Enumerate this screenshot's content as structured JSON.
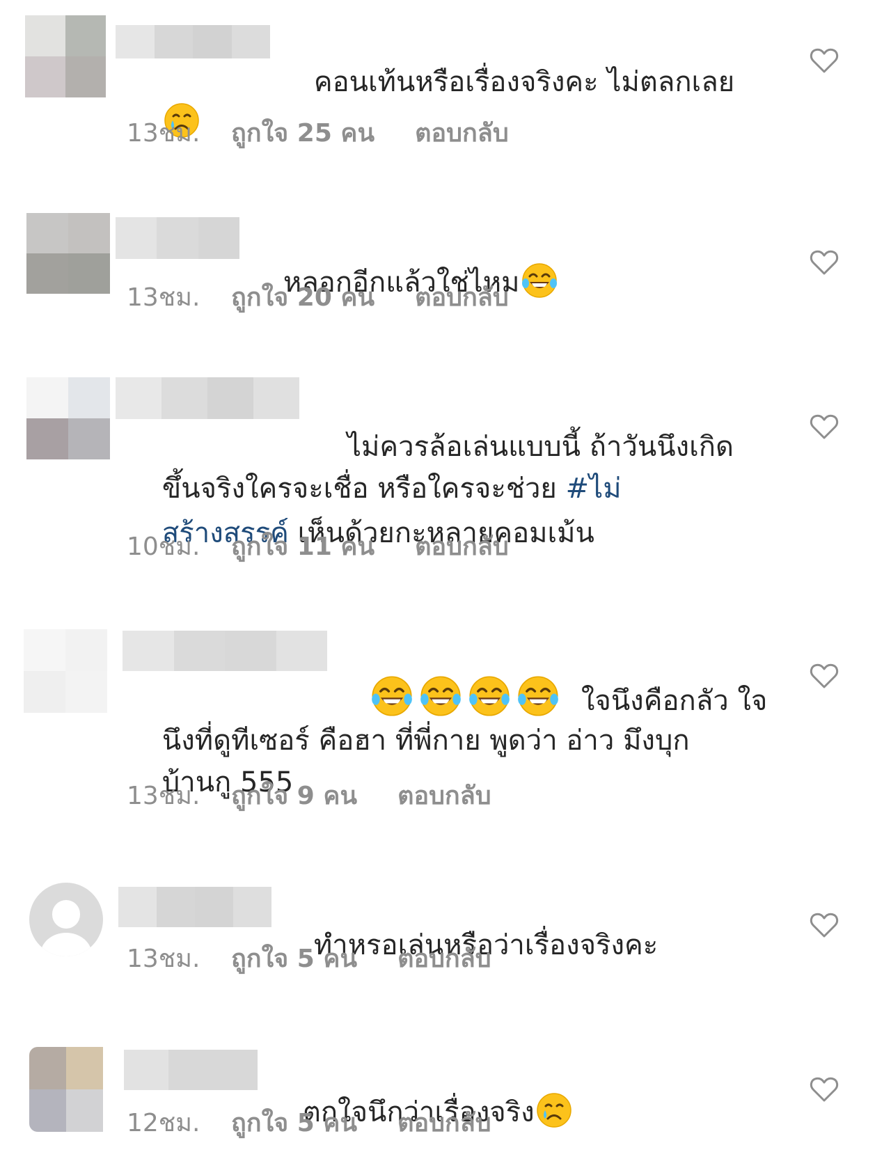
{
  "comments": [
    {
      "text_before": "คอนเท้นหรือเรื่องจริงคะ ไม่ตลกเลย",
      "emoji": "crying-face-icon",
      "time": "13ชม.",
      "likes": "ถูกใจ 25 คน",
      "reply": "ตอบกลับ"
    },
    {
      "text_before": "หลอกอีกแล้วใช่ไหม",
      "emoji": "tears-of-joy-icon",
      "time": "13ชม.",
      "likes": "ถูกใจ 20 คน",
      "reply": "ตอบกลับ"
    },
    {
      "line1": "ไม่ควรล้อเล่นแบบนี้ ถ้าวันนึงเกิด",
      "line2_text": "ขึ้นจริงใครจะเชื่อ หรือใครจะช่วย ",
      "line2_hashtag": "#ไม่",
      "line3_hashtag": "สร้างสรรค์",
      "line3_text": " เห็นด้วยกะหลายคอมเม้น",
      "time": "10ชม.",
      "likes": "ถูกใจ 11 คน",
      "reply": "ตอบกลับ"
    },
    {
      "line1": "ใจนึงคือกลัว ใจ",
      "line2": "นึงที่ดูทีเซอร์ คือฮา ที่พี่กาย พูดว่า อ่าว มึงบุก",
      "line3": "บ้านกู 555",
      "emoji": "tears-of-joy-icon",
      "time": "13ชม.",
      "likes": "ถูกใจ 9 คน",
      "reply": "ตอบกลับ"
    },
    {
      "text_before": "ทำหรอเล่นหรือว่าเรื่องจริงคะ",
      "time": "13ชม.",
      "likes": "ถูกใจ 5 คน",
      "reply": "ตอบกลับ"
    },
    {
      "text_before": "ตกใจนึกว่าเรื่องจริง",
      "emoji": "crying-face-icon",
      "time": "12ชม.",
      "likes": "ถูกใจ 5 คน",
      "reply": "ตอบกลับ"
    }
  ]
}
